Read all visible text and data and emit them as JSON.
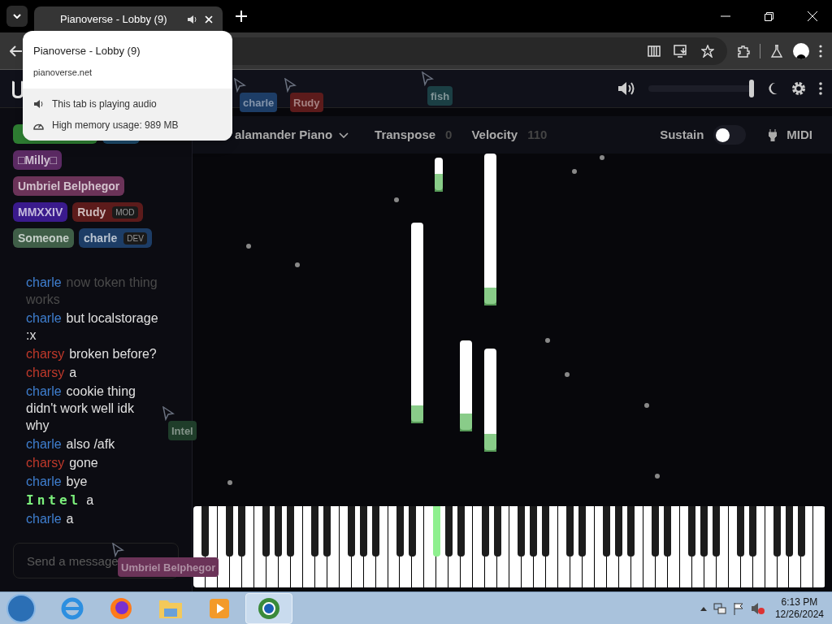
{
  "browser": {
    "tab_title": "Pianoverse - Lobby (9)",
    "tab_audio": true,
    "popup": {
      "title": "Pianoverse - Lobby (9)",
      "url": "pianoverse.net",
      "audio_note": "This tab is playing audio",
      "memory_note": "High memory usage: 989 MB"
    }
  },
  "header": {
    "volume": {
      "level": 1.0
    }
  },
  "toolbar": {
    "instrument": "alamander Piano",
    "transpose_label": "Transpose",
    "transpose_value": "0",
    "velocity_label": "Velocity",
    "velocity_value": "110",
    "sustain_label": "Sustain",
    "sustain_on": false,
    "midi_label": "MIDI"
  },
  "users": [
    {
      "color": "#2e7d32"
    },
    {
      "color": "#1e4a6a"
    },
    {
      "name": "□Milly□",
      "color": "#5b2a63"
    },
    {
      "name": "Umbriel Belphegor",
      "color": "#6b3358"
    },
    {
      "name": "MMXXIV",
      "color": "#3a1a8c"
    },
    {
      "name": "Rudy",
      "color": "#5c1b1b",
      "tag": "MOD"
    },
    {
      "name": "Someone",
      "color": "#3f5e47"
    },
    {
      "name": "charle",
      "color": "#1d3d66",
      "tag": "DEV"
    }
  ],
  "chat": [
    {
      "user": "charle",
      "color": "#3f7fd0",
      "text": "now token thing works",
      "faded": true,
      "kind": "plain"
    },
    {
      "user": "charle",
      "color": "#3f7fd0",
      "text": "but localstorage :x",
      "faded": false,
      "kind": "plain"
    },
    {
      "user": "charsy",
      "color": "#c0392b",
      "text": "broken before?",
      "faded": false,
      "kind": "plain"
    },
    {
      "user": "charsy",
      "color": "#c0392b",
      "text": "a",
      "faded": false,
      "kind": "plain"
    },
    {
      "user": "charle",
      "color": "#3f7fd0",
      "text": "cookie thing didn't work well idk why",
      "faded": false,
      "kind": "plain"
    },
    {
      "user": "charle",
      "color": "#3f7fd0",
      "text": "also /afk",
      "faded": false,
      "kind": "plain"
    },
    {
      "user": "charsy",
      "color": "#c0392b",
      "text": "gone",
      "faded": false,
      "kind": "plain"
    },
    {
      "user": "charle",
      "color": "#3f7fd0",
      "text": "bye",
      "faded": false,
      "kind": "plain"
    },
    {
      "user": "Intel",
      "color": "#7cf07c",
      "text": "a",
      "faded": false,
      "kind": "mono"
    },
    {
      "user": "charle",
      "color": "#3f7fd0",
      "text": "a",
      "faded": false,
      "kind": "plain"
    }
  ],
  "message_field": {
    "placeholder": "Send a message"
  },
  "cursors": [
    {
      "name": "charle",
      "color": "#1d3d66"
    },
    {
      "name": "Rudy",
      "color": "#5c1b1b"
    },
    {
      "name": "fish",
      "color": "#1b3f44"
    },
    {
      "name": "Intel",
      "color": "#1f3d2a"
    },
    {
      "name": "Umbriel Belphegor",
      "color": "#6b3358"
    }
  ],
  "keyboard": {
    "black_keys": [
      {
        "pressed": false
      },
      {
        "pressed": false
      },
      {
        "pressed": false
      },
      {
        "pressed": false
      },
      {
        "pressed": false
      },
      {
        "pressed": false
      },
      {
        "pressed": false
      },
      {
        "pressed": false
      },
      {
        "pressed": false
      },
      {
        "pressed": false
      },
      {
        "pressed": false
      },
      {
        "pressed": false
      },
      {
        "pressed": false
      },
      {
        "pressed": true
      },
      {
        "pressed": false
      },
      {
        "pressed": false
      },
      {
        "pressed": false
      },
      {
        "pressed": false
      },
      {
        "pressed": false
      },
      {
        "pressed": false
      },
      {
        "pressed": false
      },
      {
        "pressed": false
      },
      {
        "pressed": false
      },
      {
        "pressed": false
      },
      {
        "pressed": false
      },
      {
        "pressed": false
      },
      {
        "pressed": false
      },
      {
        "pressed": false
      },
      {
        "pressed": false
      },
      {
        "pressed": false
      },
      {
        "pressed": false
      },
      {
        "pressed": false
      },
      {
        "pressed": false
      },
      {
        "pressed": false
      },
      {
        "pressed": false
      },
      {
        "pressed": false
      }
    ]
  },
  "taskbar": {
    "time": "6:13 PM",
    "date": "12/26/2024"
  }
}
